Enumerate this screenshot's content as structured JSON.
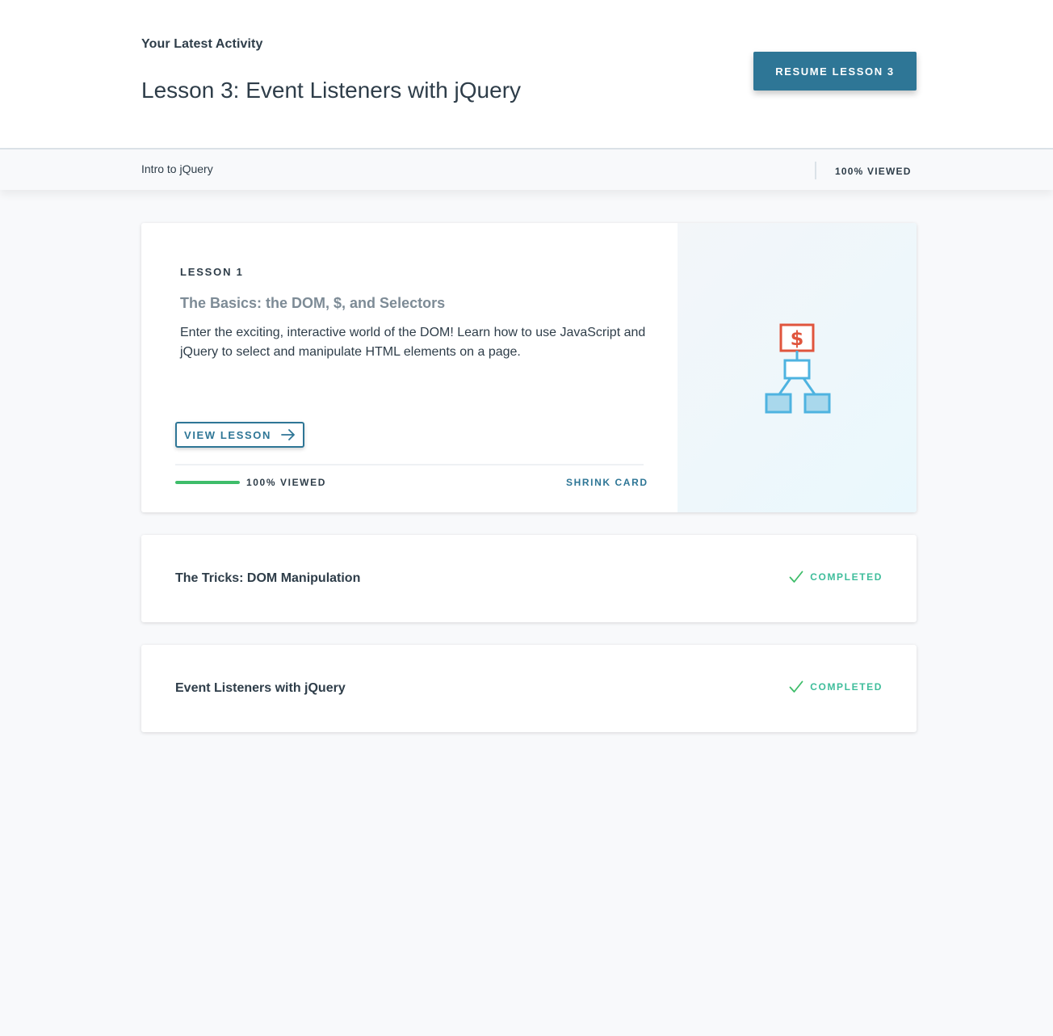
{
  "header": {
    "latest_label": "Your Latest Activity",
    "title": "Lesson 3: Event Listeners with jQuery",
    "resume_label": "RESUME LESSON 3"
  },
  "subbar": {
    "course_name": "Intro to jQuery",
    "viewed_label": "100% VIEWED"
  },
  "expanded_lesson": {
    "number_label": "LESSON 1",
    "title": "The Basics: the DOM, $, and Selectors",
    "description": "Enter the exciting, interactive world of the DOM! Learn how to use JavaScript and jQuery to select and manipulate HTML elements on a page.",
    "view_label": "VIEW LESSON",
    "progress_fraction": 1.0,
    "progress_label": "100% VIEWED",
    "shrink_label": "SHRINK CARD",
    "illustration_symbol": "$",
    "illustration_icon": "dom-tree-illustration"
  },
  "lessons": [
    {
      "title": "The Tricks: DOM Manipulation",
      "status": "COMPLETED",
      "status_icon": "checkmark-icon"
    },
    {
      "title": "Event Listeners with jQuery",
      "status": "COMPLETED",
      "status_icon": "checkmark-icon"
    }
  ],
  "colors": {
    "accent": "#2e7696",
    "text": "#2e3d49",
    "progress": "#3ebd6a",
    "completed": "#3ebd9b",
    "illustration_red": "#e0553d",
    "illustration_blue": "#4eb3e0"
  }
}
